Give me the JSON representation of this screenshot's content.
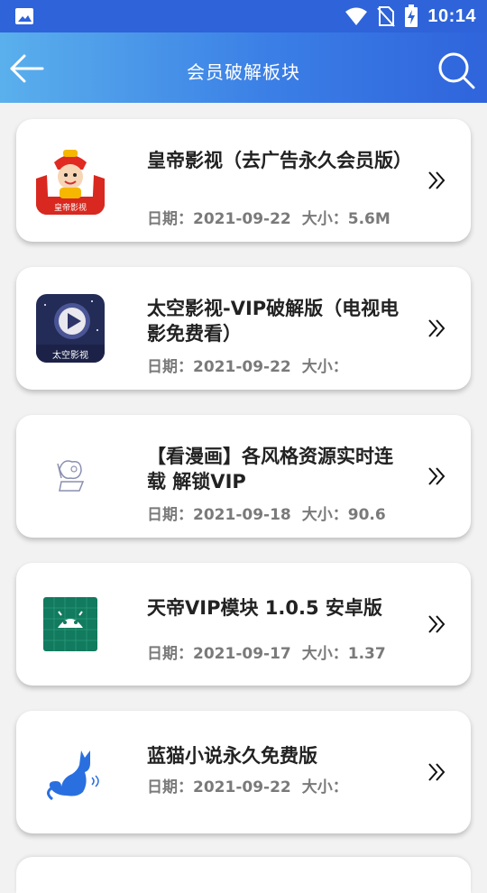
{
  "status_bar": {
    "time": "10:14",
    "icons": [
      "image-icon",
      "wifi-icon",
      "no-sim-icon",
      "battery-charging-icon"
    ]
  },
  "header": {
    "title": "会员破解板块",
    "back_icon": "arrow-left-icon",
    "search_icon": "search-icon"
  },
  "items": [
    {
      "title": "皇帝影视（去广告永久会员版）",
      "date": "日期：2021-09-22",
      "size": "大小：5.6M",
      "icon": "emperor-app-icon"
    },
    {
      "title": "太空影视-VIP破解版（电视电影免费看）",
      "date": "日期：2021-09-22",
      "size": "大小：",
      "icon": "space-video-app-icon"
    },
    {
      "title": "【看漫画】各风格资源实时连载 解锁VIP",
      "date": "日期：2021-09-18",
      "size": "大小：90.6",
      "icon": "manga-app-icon"
    },
    {
      "title": "天帝VIP模块 1.0.5 安卓版",
      "date": "日期：2021-09-17",
      "size": "大小：1.37",
      "icon": "android-app-icon"
    },
    {
      "title": "蓝猫小说永久免费版",
      "date": "日期：2021-09-22",
      "size": "大小：",
      "icon": "blue-cat-app-icon"
    }
  ],
  "colors": {
    "status_bar": "#2e63d9",
    "header_gradient_start": "#5ab0ec",
    "header_gradient_end": "#2f64dc",
    "background": "#f2f2f2",
    "title_text": "#222222",
    "meta_text": "#7a7a7a"
  }
}
